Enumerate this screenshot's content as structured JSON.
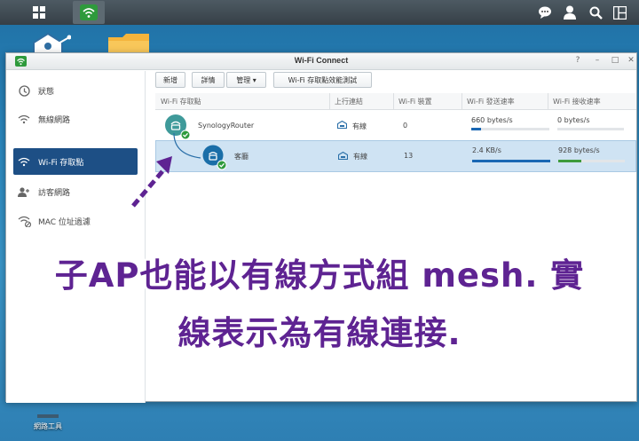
{
  "taskbar": {
    "icons": [
      "grid-icon",
      "wifi-icon",
      "chat-icon",
      "user-icon",
      "search-icon",
      "windows-icon"
    ]
  },
  "desktop": {
    "bottom_icon_label": "網路工具"
  },
  "window": {
    "title": "Wi-Fi Connect",
    "controls": [
      "?",
      "–",
      "□",
      "✕"
    ]
  },
  "sidebar": {
    "items": [
      {
        "label": "狀態",
        "icon": "status-icon"
      },
      {
        "label": "無線網路",
        "icon": "wifi-icon"
      },
      {
        "label": "Wi-Fi 存取點",
        "icon": "wifi-ap-icon",
        "active": true
      },
      {
        "label": "訪客網路",
        "icon": "guest-icon"
      },
      {
        "label": "MAC 位址過濾",
        "icon": "mac-filter-icon"
      }
    ]
  },
  "toolbar": {
    "add_label": "新增",
    "details_label": "詳情",
    "manage_label": "管理 ▾",
    "test_label": "Wi-Fi 存取點效能測試"
  },
  "grid": {
    "columns": [
      "Wi-Fi 存取點",
      "上行連結",
      "Wi-Fi 裝置",
      "Wi-Fi 發送速率",
      "Wi-Fi 接收速率"
    ],
    "rows": [
      {
        "name": "SynologyRouter",
        "uplink": "有線",
        "devices": "0",
        "tx": "660 bytes/s",
        "rx": "0 bytes/s",
        "tx_fill": 0.12,
        "rx_fill": 0.0
      },
      {
        "name": "客廳",
        "uplink": "有線",
        "devices": "13",
        "tx": "2.4 KB/s",
        "rx": "928 bytes/s",
        "tx_fill": 1.0,
        "rx_fill": 0.35
      }
    ]
  },
  "caption": {
    "line1": "子AP也能以有線方式組 mesh. 實",
    "line2": "線表示為有線連接."
  },
  "colors": {
    "accent": "#1d4f85",
    "caption": "#5e2392",
    "bar_blue": "#1a67b3",
    "bar_green": "#3e9b3c"
  }
}
